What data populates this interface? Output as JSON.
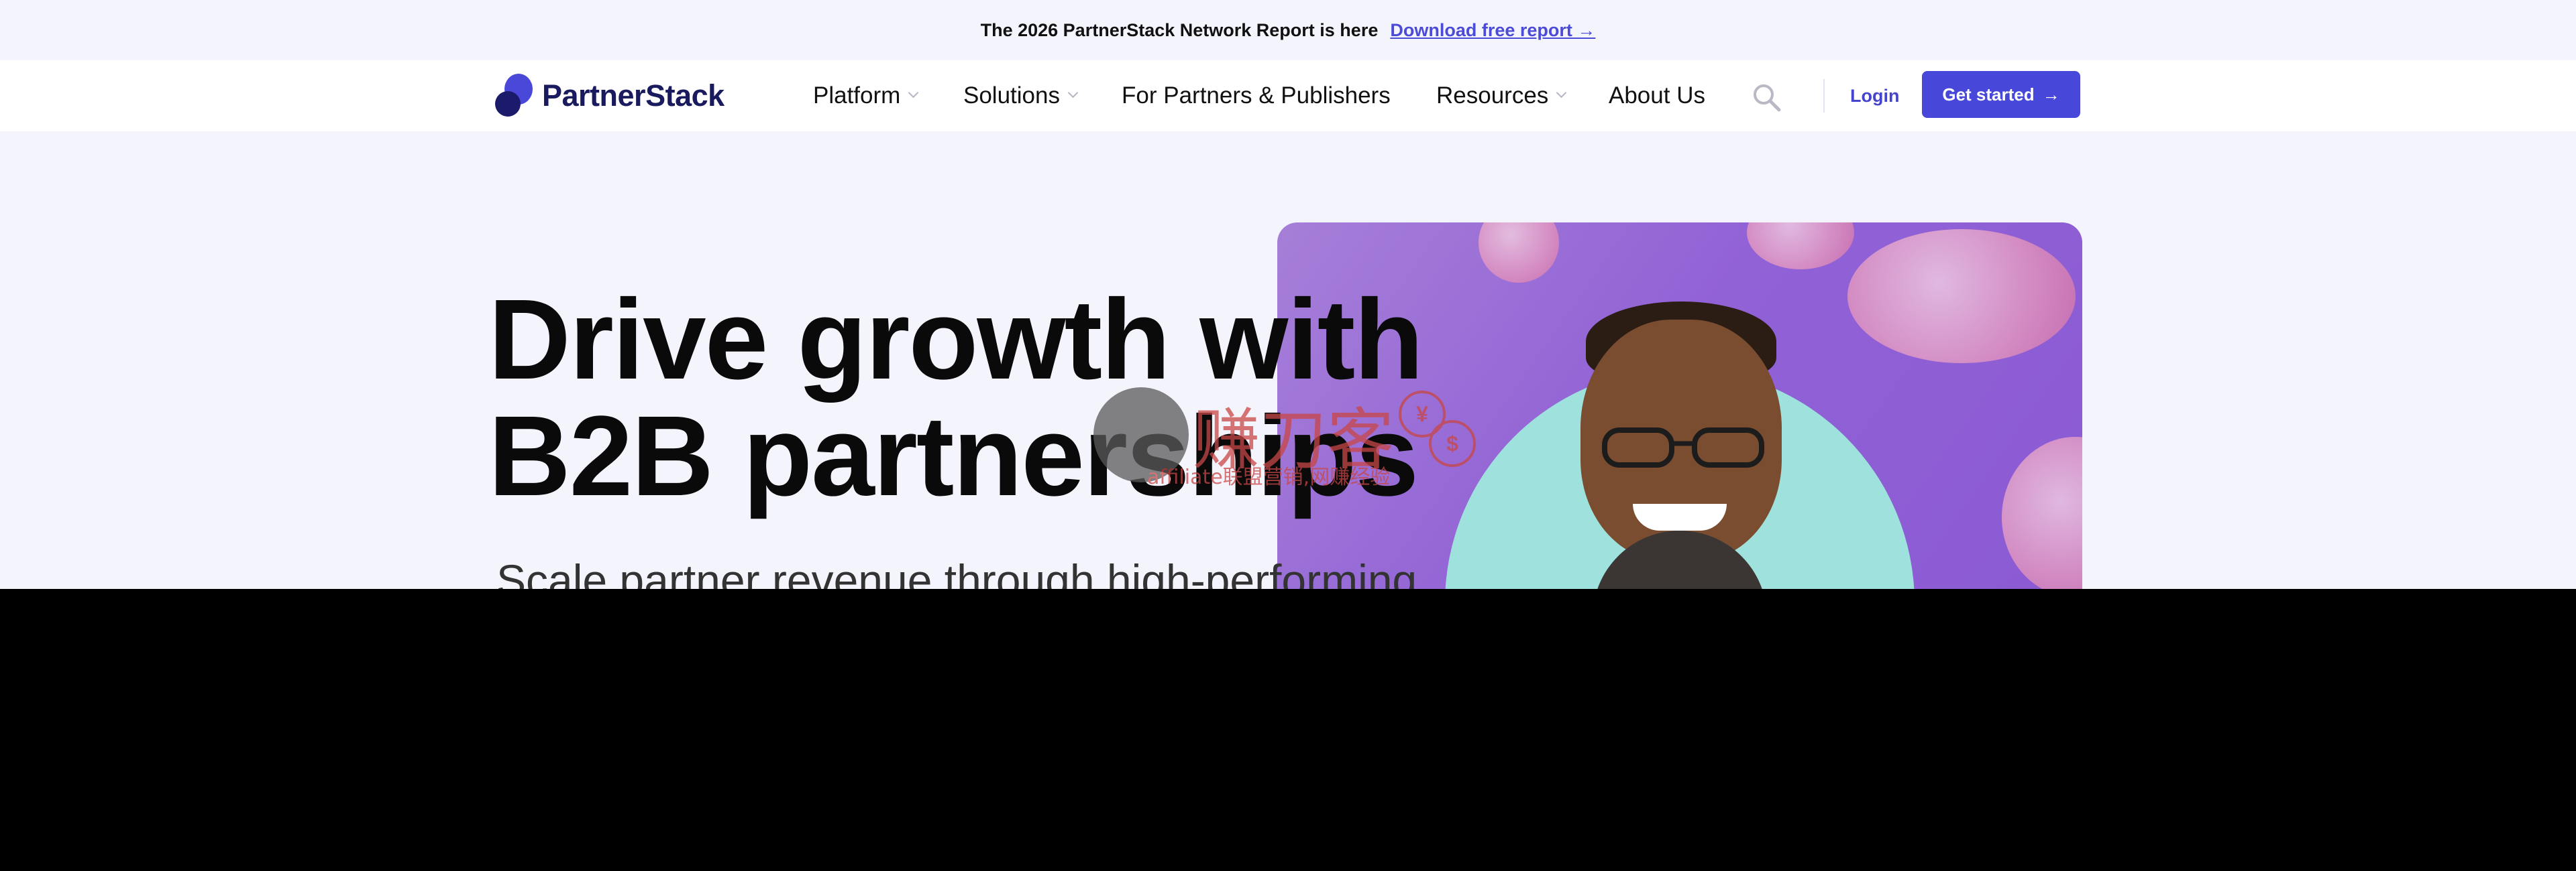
{
  "announcement": {
    "message": "The 2026 PartnerStack Network Report is here",
    "link_label": "Download free report →"
  },
  "nav": {
    "logo_text": "PartnerStack",
    "items": [
      {
        "label": "Platform",
        "has_dropdown": true
      },
      {
        "label": "Solutions",
        "has_dropdown": true
      },
      {
        "label": "For Partners & Publishers",
        "has_dropdown": false
      },
      {
        "label": "Resources",
        "has_dropdown": true
      },
      {
        "label": "About Us",
        "has_dropdown": false
      }
    ],
    "search_icon": "search-icon",
    "login_label": "Login",
    "cta_label": "Get started",
    "cta_arrow": "→"
  },
  "hero": {
    "headline_line1": "Drive growth with",
    "headline_line2": "B2B partnerships",
    "subheadline": "Scale partner revenue through high-performing"
  },
  "watermark": {
    "title": "赚刀客",
    "subtitle": "affiliate联盟营销,网赚经验"
  },
  "colors": {
    "brand": "#4747d9",
    "brand_dark": "#1a1a5e",
    "page_bg": "#f4f4fd",
    "hero_photo_bg": "#9162d6",
    "teal_circle": "#9fe2dd"
  }
}
